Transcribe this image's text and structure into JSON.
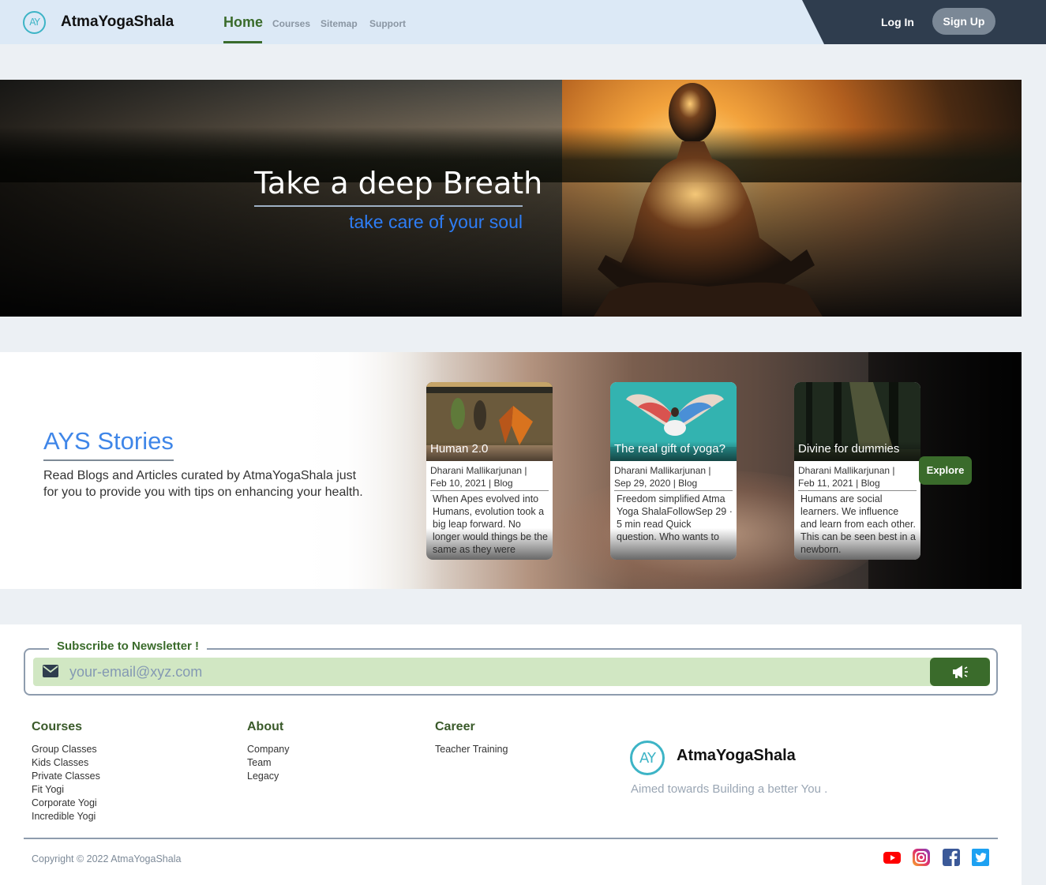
{
  "nav": {
    "logo_mark": "AY",
    "brand": "AtmaYogaShala",
    "links": [
      {
        "label": "Home",
        "active": true
      },
      {
        "label": "Courses",
        "active": false
      },
      {
        "label": "Sitemap",
        "active": false
      },
      {
        "label": "Support",
        "active": false
      }
    ],
    "login": "Log In",
    "signup": "Sign Up"
  },
  "hero": {
    "title": "Take a deep Breath",
    "subtitle": "take care of your soul"
  },
  "stories": {
    "title": "AYS Stories",
    "description": "Read Blogs and Articles curated by AtmaYogaShala just for you to provide you with tips on enhancing your health.",
    "cards": [
      {
        "title": "Human 2.0",
        "author": "Dharani Mallikarjunan |",
        "meta": "Feb 10, 2021 | Blog",
        "excerpt": "When Apes evolved into Humans, evolution took a big leap forward. No longer would things be the same as they were"
      },
      {
        "title": "The real gift of yoga?",
        "author": "Dharani Mallikarjunan |",
        "meta": "Sep 29, 2020 | Blog",
        "excerpt": "Freedom simplified Atma Yoga ShalaFollowSep 29 · 5 min read Quick question. Who wants to"
      },
      {
        "title": "Divine for dummies",
        "author": "Dharani Mallikarjunan |",
        "meta": "Feb 11, 2021 | Blog",
        "excerpt": "Humans are social learners. We influence and learn from each other. This can be seen best in a newborn."
      }
    ],
    "explore": "Explore"
  },
  "newsletter": {
    "legend": "Subscribe to Newsletter !",
    "placeholder": "your-email@xyz.com",
    "mail_icon": "mail-icon",
    "submit_icon": "megaphone-icon"
  },
  "footer": {
    "columns": [
      {
        "heading": "Courses",
        "items": [
          "Group Classes",
          "Kids Classes",
          "Private Classes",
          "Fit Yogi",
          "Corporate Yogi",
          "Incredible Yogi"
        ]
      },
      {
        "heading": "About",
        "items": [
          "Company",
          "Team",
          "Legacy"
        ]
      },
      {
        "heading": "Career",
        "items": [
          "Teacher Training"
        ]
      }
    ],
    "logo_mark": "AY",
    "brand": "AtmaYogaShala",
    "tagline": "Aimed towards Building a better You .",
    "copyright": "Copyright © 2022 AtmaYogaShala",
    "social": [
      "youtube-icon",
      "instagram-icon",
      "facebook-icon",
      "twitter-icon"
    ]
  },
  "colors": {
    "accent_green": "#3a6b2b",
    "link_blue": "#3f86e8",
    "logo_teal": "#3db4c6",
    "nav_bg": "#dce9f6",
    "newsletter_bg": "#d1e7c3"
  }
}
